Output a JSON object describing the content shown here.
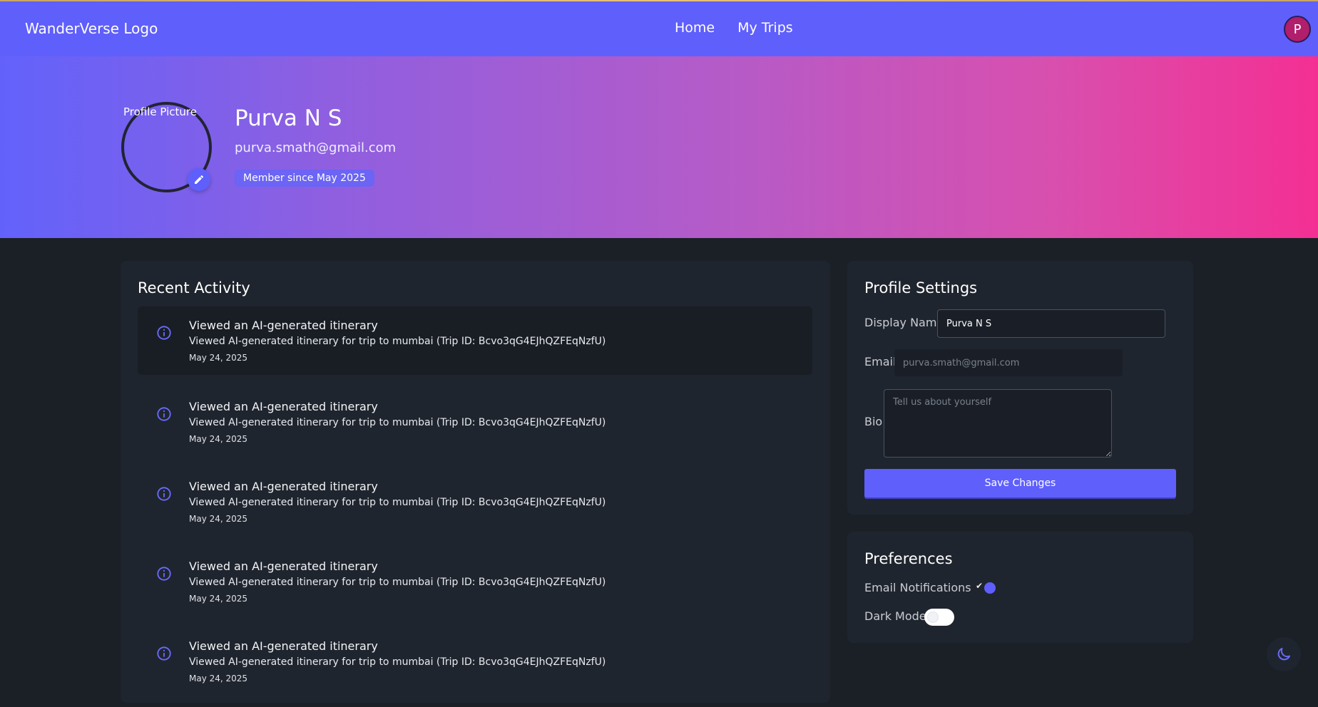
{
  "navbar": {
    "logo": "WanderVerse Logo",
    "links": [
      "Home",
      "My Trips"
    ],
    "avatar_initial": "P"
  },
  "profile": {
    "picture_label": "Profile Picture",
    "name": "Purva N S",
    "email": "purva.smath@gmail.com",
    "member_since": "Member since May 2025"
  },
  "activity": {
    "title": "Recent Activity",
    "items": [
      {
        "title": "Viewed an AI-generated itinerary",
        "desc": "Viewed AI-generated itinerary for trip to mumbai (Trip ID: Bcvo3qG4EJhQZFEqNzfU)",
        "date": "May 24, 2025"
      },
      {
        "title": "Viewed an AI-generated itinerary",
        "desc": "Viewed AI-generated itinerary for trip to mumbai (Trip ID: Bcvo3qG4EJhQZFEqNzfU)",
        "date": "May 24, 2025"
      },
      {
        "title": "Viewed an AI-generated itinerary",
        "desc": "Viewed AI-generated itinerary for trip to mumbai (Trip ID: Bcvo3qG4EJhQZFEqNzfU)",
        "date": "May 24, 2025"
      },
      {
        "title": "Viewed an AI-generated itinerary",
        "desc": "Viewed AI-generated itinerary for trip to mumbai (Trip ID: Bcvo3qG4EJhQZFEqNzfU)",
        "date": "May 24, 2025"
      },
      {
        "title": "Viewed an AI-generated itinerary",
        "desc": "Viewed AI-generated itinerary for trip to mumbai (Trip ID: Bcvo3qG4EJhQZFEqNzfU)",
        "date": "May 24, 2025"
      }
    ]
  },
  "settings": {
    "title": "Profile Settings",
    "display_name_label": "Display Name",
    "display_name_value": "Purva N S",
    "email_label": "Email",
    "email_placeholder": "purva.smath@gmail.com",
    "bio_label": "Bio",
    "bio_placeholder": "Tell us about yourself",
    "save_label": "Save Changes"
  },
  "preferences": {
    "title": "Preferences",
    "email_notifications_label": "Email Notifications",
    "email_notifications_on": true,
    "dark_mode_label": "Dark Mode",
    "dark_mode_on": false
  },
  "colors": {
    "accent": "#5f5ffc",
    "background": "#1b2027",
    "card": "#1f252e",
    "hero_start": "#6262fb",
    "hero_end": "#f42f93",
    "avatar": "#b01e6c"
  },
  "icons": {
    "activity": "info-circle-icon",
    "edit": "pencil-icon",
    "theme": "moon-icon"
  }
}
